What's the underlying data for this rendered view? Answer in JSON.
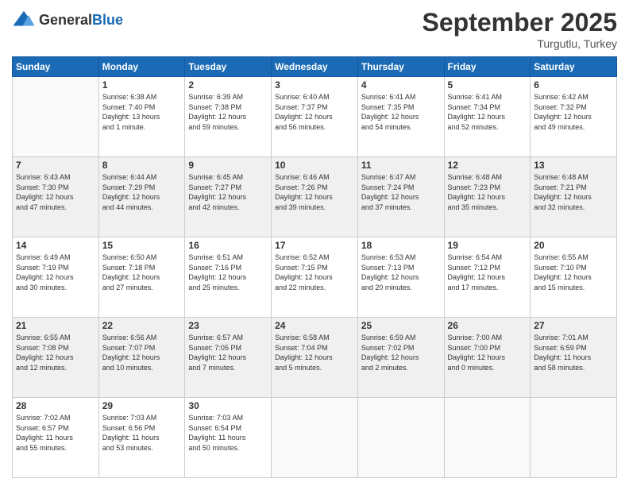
{
  "header": {
    "logo_general": "General",
    "logo_blue": "Blue",
    "month_title": "September 2025",
    "subtitle": "Turgutlu, Turkey"
  },
  "days_of_week": [
    "Sunday",
    "Monday",
    "Tuesday",
    "Wednesday",
    "Thursday",
    "Friday",
    "Saturday"
  ],
  "weeks": [
    [
      {
        "day": "",
        "info": ""
      },
      {
        "day": "1",
        "info": "Sunrise: 6:38 AM\nSunset: 7:40 PM\nDaylight: 13 hours\nand 1 minute."
      },
      {
        "day": "2",
        "info": "Sunrise: 6:39 AM\nSunset: 7:38 PM\nDaylight: 12 hours\nand 59 minutes."
      },
      {
        "day": "3",
        "info": "Sunrise: 6:40 AM\nSunset: 7:37 PM\nDaylight: 12 hours\nand 56 minutes."
      },
      {
        "day": "4",
        "info": "Sunrise: 6:41 AM\nSunset: 7:35 PM\nDaylight: 12 hours\nand 54 minutes."
      },
      {
        "day": "5",
        "info": "Sunrise: 6:41 AM\nSunset: 7:34 PM\nDaylight: 12 hours\nand 52 minutes."
      },
      {
        "day": "6",
        "info": "Sunrise: 6:42 AM\nSunset: 7:32 PM\nDaylight: 12 hours\nand 49 minutes."
      }
    ],
    [
      {
        "day": "7",
        "info": "Sunrise: 6:43 AM\nSunset: 7:30 PM\nDaylight: 12 hours\nand 47 minutes."
      },
      {
        "day": "8",
        "info": "Sunrise: 6:44 AM\nSunset: 7:29 PM\nDaylight: 12 hours\nand 44 minutes."
      },
      {
        "day": "9",
        "info": "Sunrise: 6:45 AM\nSunset: 7:27 PM\nDaylight: 12 hours\nand 42 minutes."
      },
      {
        "day": "10",
        "info": "Sunrise: 6:46 AM\nSunset: 7:26 PM\nDaylight: 12 hours\nand 39 minutes."
      },
      {
        "day": "11",
        "info": "Sunrise: 6:47 AM\nSunset: 7:24 PM\nDaylight: 12 hours\nand 37 minutes."
      },
      {
        "day": "12",
        "info": "Sunrise: 6:48 AM\nSunset: 7:23 PM\nDaylight: 12 hours\nand 35 minutes."
      },
      {
        "day": "13",
        "info": "Sunrise: 6:48 AM\nSunset: 7:21 PM\nDaylight: 12 hours\nand 32 minutes."
      }
    ],
    [
      {
        "day": "14",
        "info": "Sunrise: 6:49 AM\nSunset: 7:19 PM\nDaylight: 12 hours\nand 30 minutes."
      },
      {
        "day": "15",
        "info": "Sunrise: 6:50 AM\nSunset: 7:18 PM\nDaylight: 12 hours\nand 27 minutes."
      },
      {
        "day": "16",
        "info": "Sunrise: 6:51 AM\nSunset: 7:16 PM\nDaylight: 12 hours\nand 25 minutes."
      },
      {
        "day": "17",
        "info": "Sunrise: 6:52 AM\nSunset: 7:15 PM\nDaylight: 12 hours\nand 22 minutes."
      },
      {
        "day": "18",
        "info": "Sunrise: 6:53 AM\nSunset: 7:13 PM\nDaylight: 12 hours\nand 20 minutes."
      },
      {
        "day": "19",
        "info": "Sunrise: 6:54 AM\nSunset: 7:12 PM\nDaylight: 12 hours\nand 17 minutes."
      },
      {
        "day": "20",
        "info": "Sunrise: 6:55 AM\nSunset: 7:10 PM\nDaylight: 12 hours\nand 15 minutes."
      }
    ],
    [
      {
        "day": "21",
        "info": "Sunrise: 6:55 AM\nSunset: 7:08 PM\nDaylight: 12 hours\nand 12 minutes."
      },
      {
        "day": "22",
        "info": "Sunrise: 6:56 AM\nSunset: 7:07 PM\nDaylight: 12 hours\nand 10 minutes."
      },
      {
        "day": "23",
        "info": "Sunrise: 6:57 AM\nSunset: 7:05 PM\nDaylight: 12 hours\nand 7 minutes."
      },
      {
        "day": "24",
        "info": "Sunrise: 6:58 AM\nSunset: 7:04 PM\nDaylight: 12 hours\nand 5 minutes."
      },
      {
        "day": "25",
        "info": "Sunrise: 6:59 AM\nSunset: 7:02 PM\nDaylight: 12 hours\nand 2 minutes."
      },
      {
        "day": "26",
        "info": "Sunrise: 7:00 AM\nSunset: 7:00 PM\nDaylight: 12 hours\nand 0 minutes."
      },
      {
        "day": "27",
        "info": "Sunrise: 7:01 AM\nSunset: 6:59 PM\nDaylight: 11 hours\nand 58 minutes."
      }
    ],
    [
      {
        "day": "28",
        "info": "Sunrise: 7:02 AM\nSunset: 6:57 PM\nDaylight: 11 hours\nand 55 minutes."
      },
      {
        "day": "29",
        "info": "Sunrise: 7:03 AM\nSunset: 6:56 PM\nDaylight: 11 hours\nand 53 minutes."
      },
      {
        "day": "30",
        "info": "Sunrise: 7:03 AM\nSunset: 6:54 PM\nDaylight: 11 hours\nand 50 minutes."
      },
      {
        "day": "",
        "info": ""
      },
      {
        "day": "",
        "info": ""
      },
      {
        "day": "",
        "info": ""
      },
      {
        "day": "",
        "info": ""
      }
    ]
  ]
}
